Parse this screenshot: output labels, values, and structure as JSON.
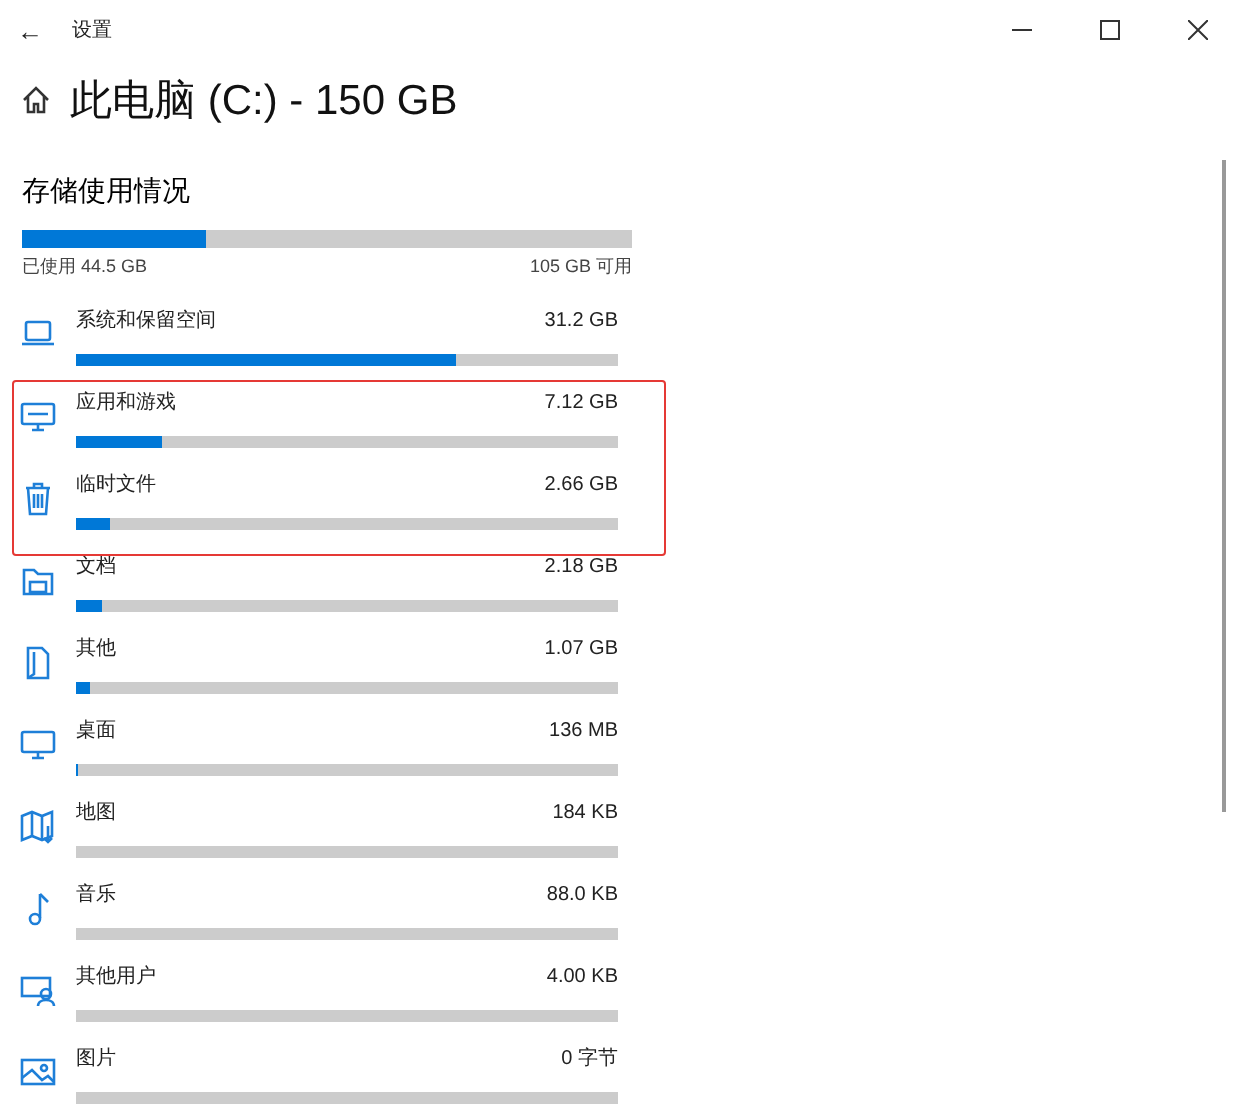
{
  "window": {
    "title": "设置",
    "back": "←"
  },
  "heading": "此电脑 (C:) - 150 GB",
  "usage": {
    "title": "存储使用情况",
    "level": 0.3,
    "used": "已使用 44.5 GB",
    "free": "105 GB 可用"
  },
  "categories": [
    {
      "kind": "laptop",
      "name": "系统和保留空间",
      "size": "31.2 GB",
      "level": 0.7,
      "highlighted": false
    },
    {
      "kind": "apps",
      "name": "应用和游戏",
      "size": "7.12 GB",
      "level": 0.16,
      "highlighted": true
    },
    {
      "kind": "trash",
      "name": "临时文件",
      "size": "2.66 GB",
      "level": 0.063,
      "highlighted": true
    },
    {
      "kind": "folder",
      "name": "文档",
      "size": "2.18 GB",
      "level": 0.048,
      "highlighted": false
    },
    {
      "kind": "file",
      "name": "其他",
      "size": "1.07 GB",
      "level": 0.026,
      "highlighted": false
    },
    {
      "kind": "monitor",
      "name": "桌面",
      "size": "136 MB",
      "level": 0.004,
      "highlighted": false
    },
    {
      "kind": "map",
      "name": "地图",
      "size": "184 KB",
      "level": 0,
      "highlighted": false
    },
    {
      "kind": "music",
      "name": "音乐",
      "size": "88.0 KB",
      "level": 0,
      "highlighted": false
    },
    {
      "kind": "user",
      "name": "其他用户",
      "size": "4.00 KB",
      "level": 0,
      "highlighted": false
    },
    {
      "kind": "image",
      "name": "图片",
      "size": "0 字节",
      "level": 0,
      "highlighted": false
    }
  ]
}
